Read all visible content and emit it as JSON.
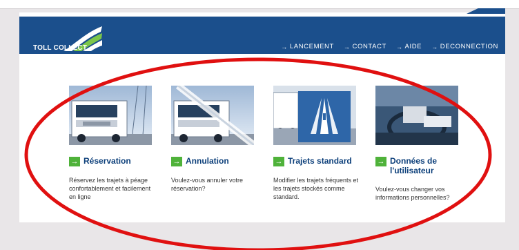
{
  "brand": {
    "logo_text": "TOLL COLLECT"
  },
  "nav": [
    {
      "label": "LANCEMENT"
    },
    {
      "label": "CONTACT"
    },
    {
      "label": "AIDE"
    },
    {
      "label": "DECONNECTION"
    }
  ],
  "cards": [
    {
      "title": "Réservation",
      "description": "Réservez les trajets à péage confortablement et facilement en ligne",
      "image_icon": "truck-photo-icon"
    },
    {
      "title": "Annulation",
      "description": "Voulez-vous annuler votre réservation?",
      "image_icon": "truck-cancelled-photo-icon"
    },
    {
      "title": "Trajets standard",
      "description": "Modifier les trajets fréquents et les trajets stockés comme standard.",
      "image_icon": "road-sign-photo-icon"
    },
    {
      "title": "Données de l'utilisateur",
      "description": "Voulez-vous changer vos informations personnelles?",
      "image_icon": "driver-photo-icon"
    }
  ],
  "colors": {
    "header": "#1b4f8c",
    "accent_green": "#4fb23a",
    "title_blue": "#0c3f7a",
    "annotation_red": "#e01010"
  }
}
